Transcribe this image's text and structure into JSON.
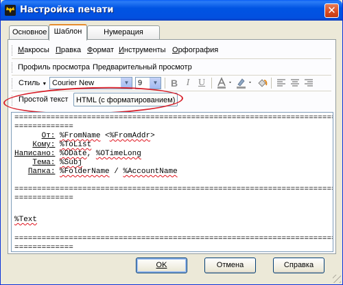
{
  "window": {
    "title": "Настройка печати",
    "close_glyph": "✕"
  },
  "tabs": [
    {
      "label": "Основное",
      "active": false
    },
    {
      "label": "Шаблон",
      "active": true
    },
    {
      "label": "Нумерация страниц",
      "active": false
    }
  ],
  "menu": {
    "items": [
      {
        "label": "Макросы",
        "underline": "М",
        "rest": "акросы"
      },
      {
        "label": "Правка",
        "underline": "П",
        "rest": "равка"
      },
      {
        "label": "Формат",
        "underline": "Ф",
        "rest": "ормат"
      },
      {
        "label": "Инструменты",
        "underline": "И",
        "rest": "нструменты"
      },
      {
        "label": "Орфография",
        "underline": "О",
        "rest": "рфография"
      }
    ]
  },
  "view_row": {
    "profile": "Профиль просмотра",
    "preview": "Предварительный просмотр"
  },
  "format_toolbar": {
    "style_label": "Стиль",
    "font_value": "Courier New",
    "size_value": "9",
    "bold_glyph": "B",
    "italic_glyph": "I",
    "underline_glyph": "U"
  },
  "mode": {
    "plain_text": "Простой текст",
    "html_text": "HTML (с форматированием)",
    "selected": "html",
    "highlight_color": "#d8202a"
  },
  "editor": {
    "separator": "=================================================================================",
    "separator_short": "=============",
    "fields": [
      {
        "label": "От:",
        "value_parts": [
          "%FromName",
          " <",
          "%FromAddr",
          ">"
        ]
      },
      {
        "label": "Кому:",
        "value_parts": [
          "%ToList"
        ]
      },
      {
        "label": "Написано:",
        "value_parts": [
          "%ODate",
          ", ",
          "%OTimeLong"
        ]
      },
      {
        "label": "Тема:",
        "value_parts": [
          "%Subj"
        ]
      },
      {
        "label": "Папка:",
        "value_parts": [
          "%FolderName",
          " / ",
          "%AccountName"
        ]
      }
    ],
    "body_macro": "%Text"
  },
  "buttons": {
    "ok": "OK",
    "cancel": "Отмена",
    "help": "Справка"
  }
}
